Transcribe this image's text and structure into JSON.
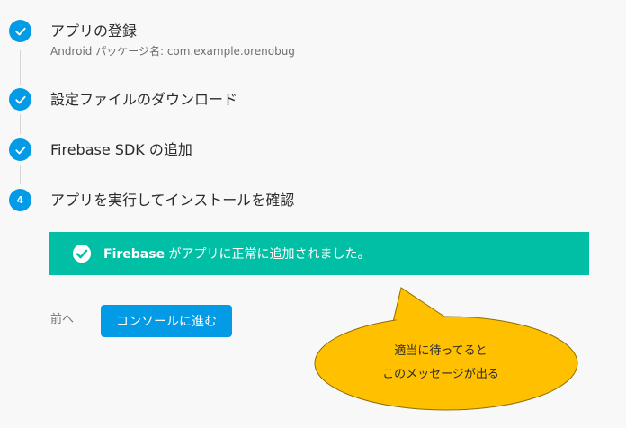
{
  "steps": [
    {
      "status": "done",
      "title": "アプリの登録",
      "subtitle": "Android パッケージ名: com.example.orenobug"
    },
    {
      "status": "done",
      "title": "設定ファイルのダウンロード"
    },
    {
      "status": "done",
      "title": "Firebase SDK の追加"
    },
    {
      "status": "current",
      "number": "4",
      "title": "アプリを実行してインストールを確認"
    }
  ],
  "banner": {
    "brand": "Firebase",
    "message": " がアプリに正常に追加されました。",
    "color": "#00bfa5",
    "icon": "check-circle-icon"
  },
  "actions": {
    "prev_label": "前へ",
    "continue_label": "コンソールに進む"
  },
  "annotation": {
    "line1": "適当に待ってると",
    "line2": "このメッセージが出る",
    "fill": "#ffc000"
  },
  "colors": {
    "accent": "#039be5",
    "success": "#00bfa5"
  }
}
